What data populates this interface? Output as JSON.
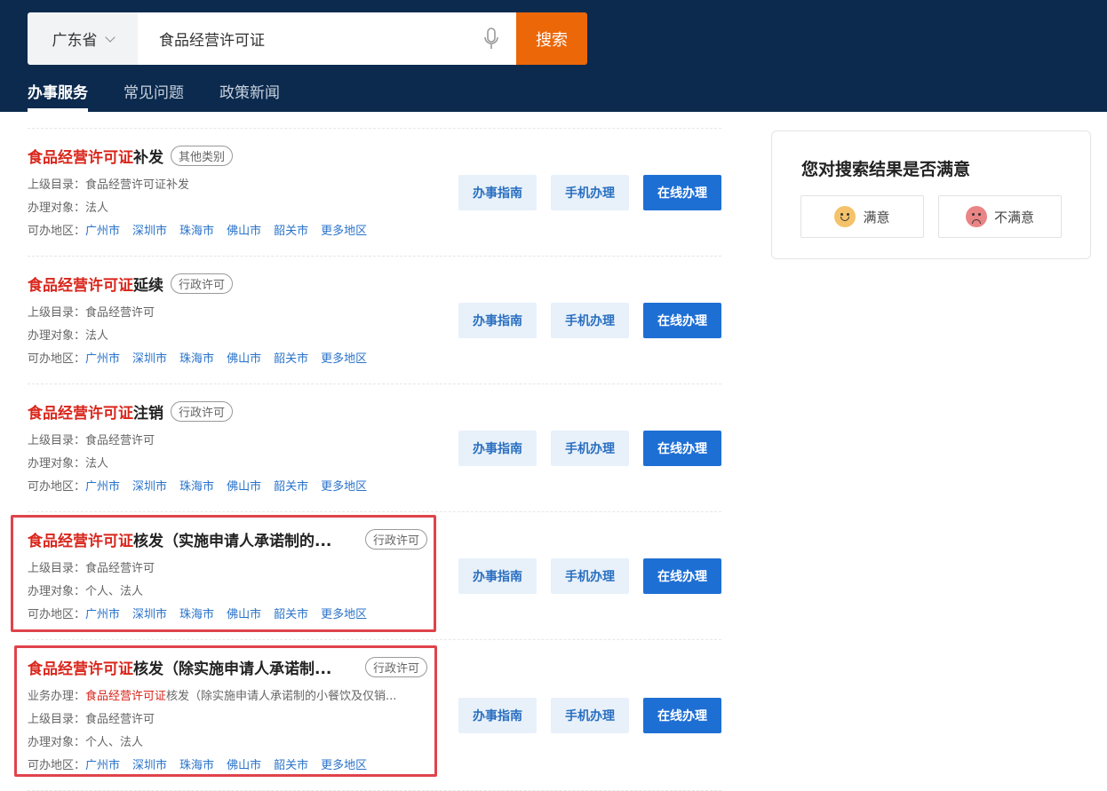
{
  "search": {
    "region": "广东省",
    "query": "食品经营许可证",
    "button": "搜索"
  },
  "tabs": [
    {
      "label": "办事服务",
      "active": true
    },
    {
      "label": "常见问题"
    },
    {
      "label": "政策新闻"
    }
  ],
  "labels": {
    "parent": "上级目录：",
    "target": "办理对象：",
    "area": "可办地区：",
    "business": "业务办理："
  },
  "buttons": {
    "guide": "办事指南",
    "mobile": "手机办理",
    "online": "在线办理"
  },
  "cities": [
    "广州市",
    "深圳市",
    "珠海市",
    "佛山市",
    "韶关市",
    "更多地区"
  ],
  "results": [
    {
      "highlight": "食品经营许可证",
      "rest": "补发",
      "tag": "其他类别",
      "parent": "食品经营许可证补发",
      "target": "法人"
    },
    {
      "highlight": "食品经营许可证",
      "rest": "延续",
      "tag": "行政许可",
      "parent": "食品经营许可",
      "target": "法人"
    },
    {
      "highlight": "食品经营许可证",
      "rest": "注销",
      "tag": "行政许可",
      "parent": "食品经营许可",
      "target": "法人"
    },
    {
      "highlight": "食品经营许可证",
      "rest": "核发（实施申请人承诺制的...",
      "tag": "行政许可",
      "parent": "食品经营许可",
      "target": "个人、法人",
      "marked": true
    },
    {
      "highlight": "食品经营许可证",
      "rest": "核发（除实施申请人承诺制...",
      "tag": "行政许可",
      "business_hl": "食品经营许可证",
      "business_rest": "核发（除实施申请人承诺制的小餐饮及仅销...",
      "parent": "食品经营许可",
      "target": "个人、法人",
      "marked": true
    }
  ],
  "feedback": {
    "title": "您对搜索结果是否满意",
    "yes": "满意",
    "no": "不满意"
  },
  "colors": {
    "header": "#0c2a4e",
    "search_button": "#ec6708",
    "highlight": "#d9261c",
    "primary": "#1e6fd4",
    "link": "#2a73c9",
    "annotation": "#e0434a"
  }
}
